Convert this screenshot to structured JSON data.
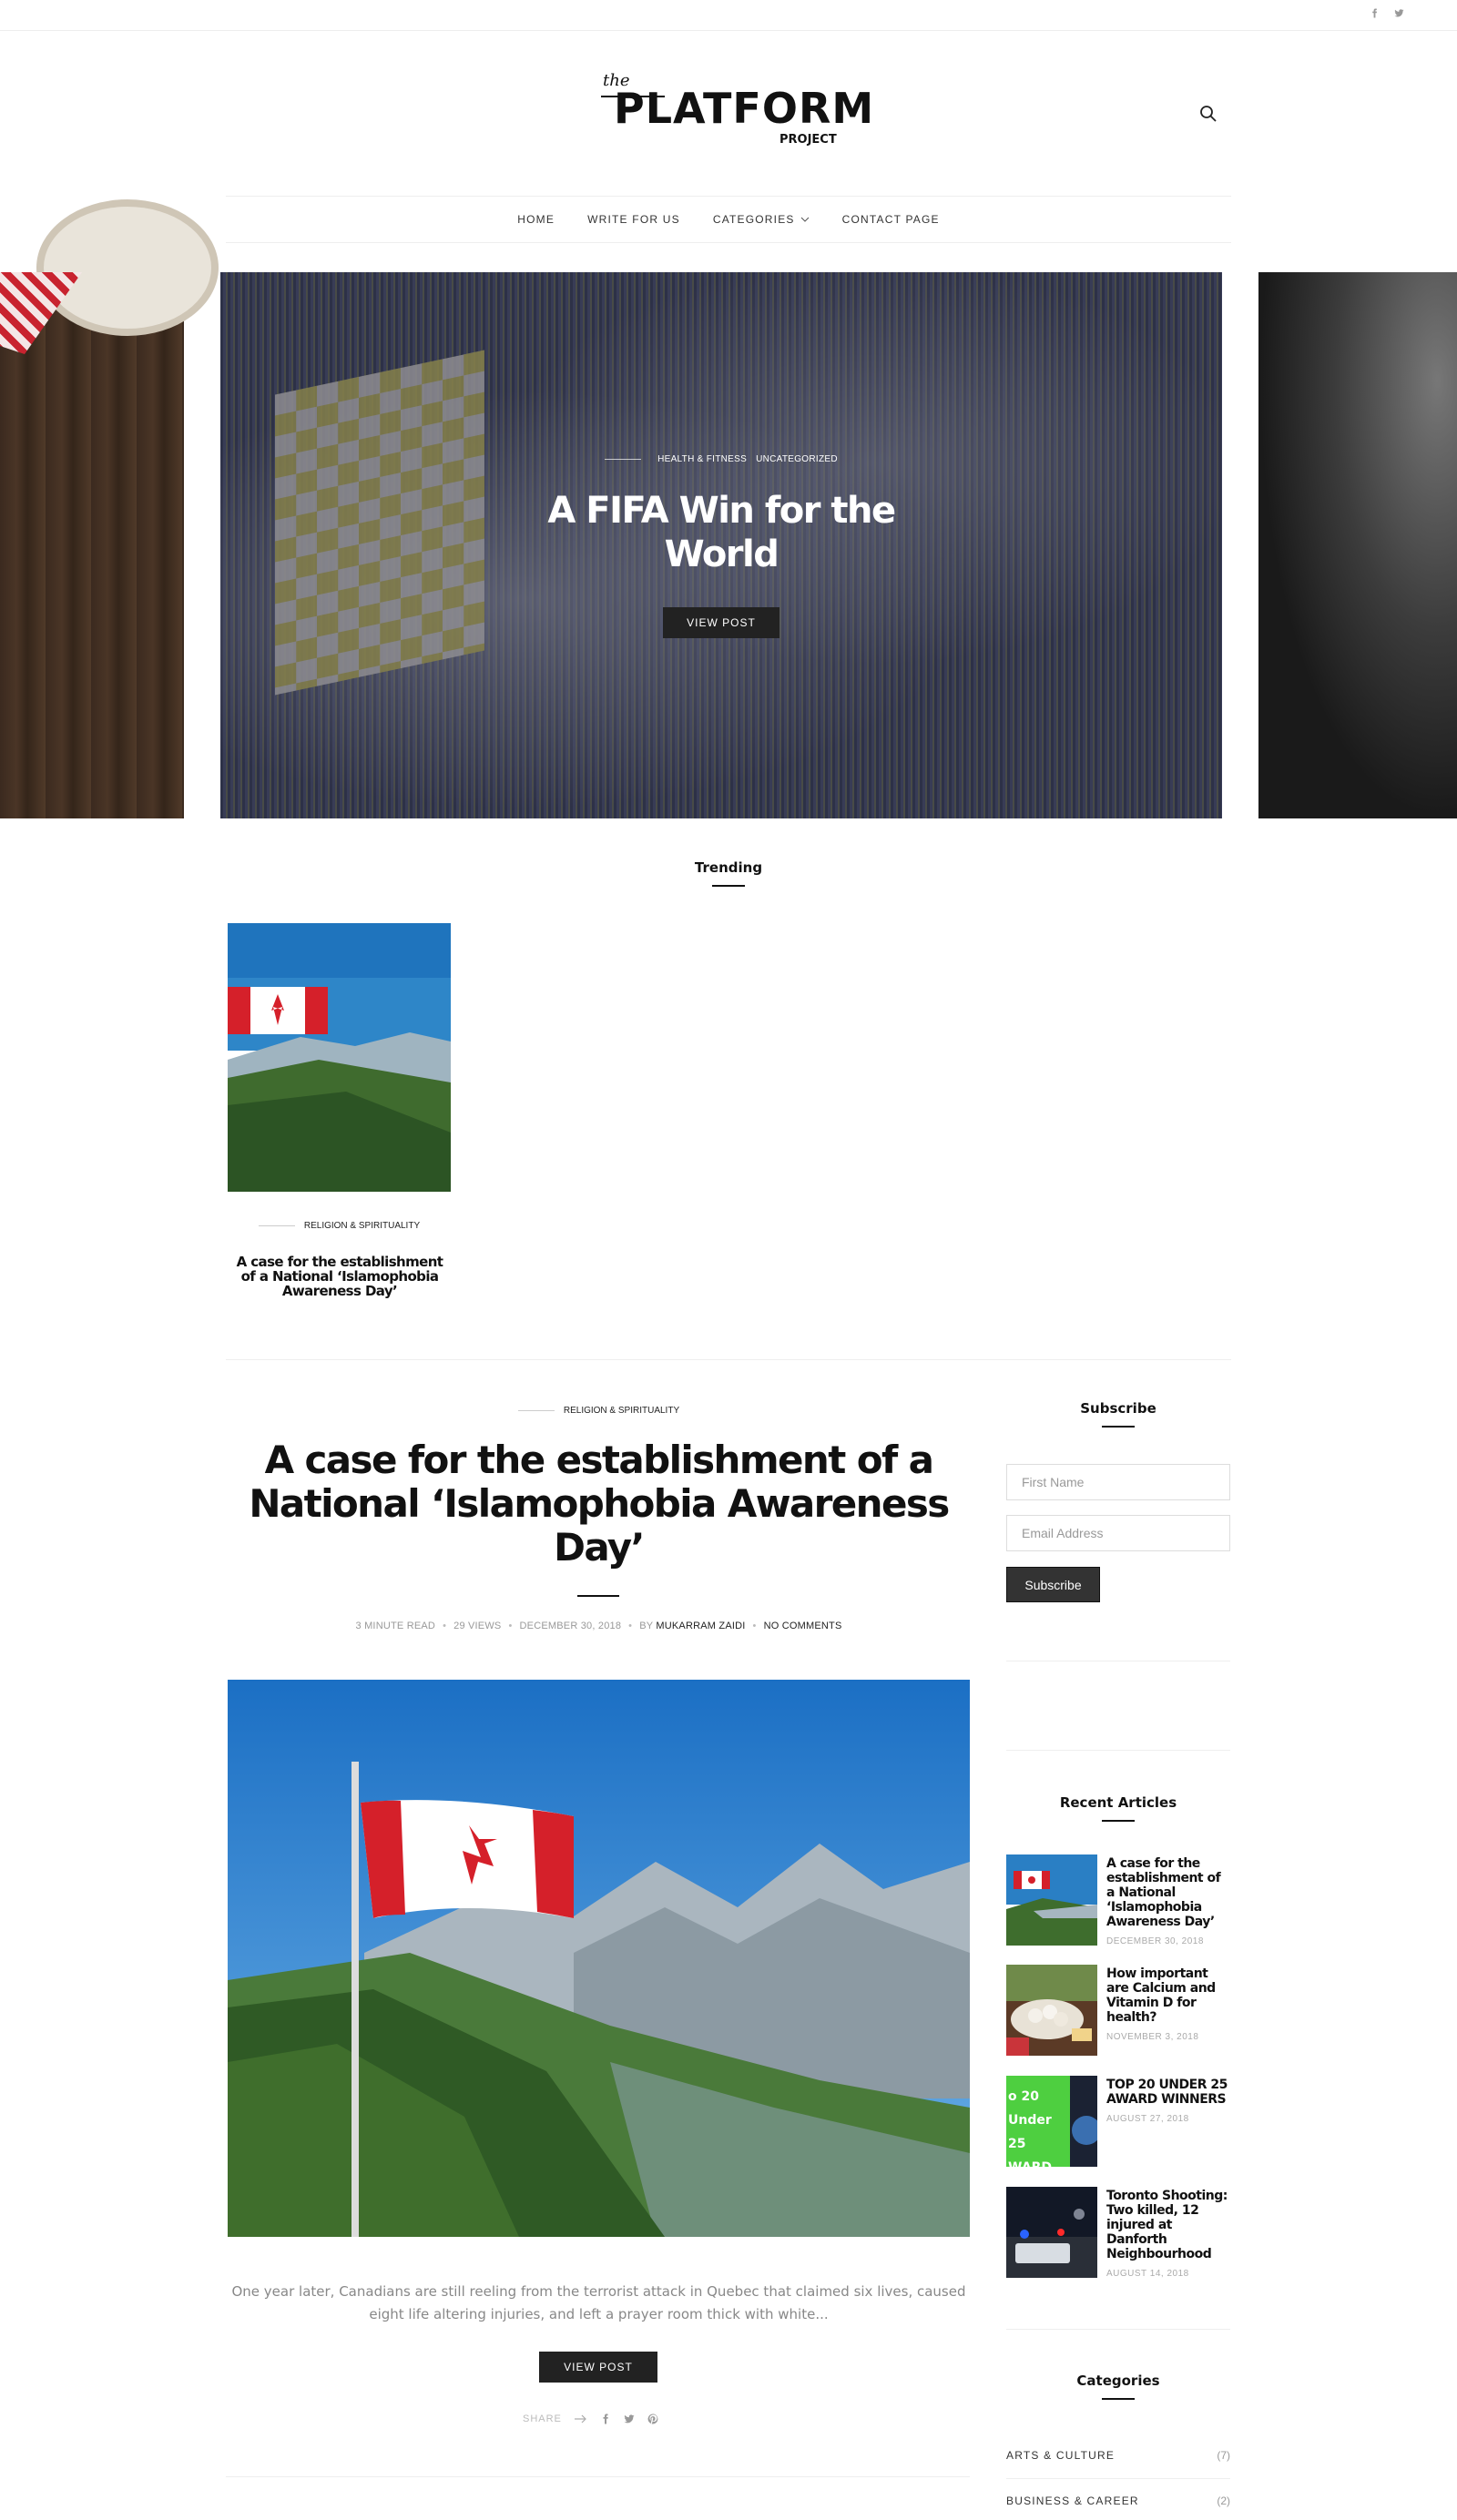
{
  "header": {
    "social": [
      "facebook-icon",
      "twitter-icon"
    ],
    "logo": {
      "the": "the",
      "main": "PLATFORM",
      "sub": "PROJECT"
    }
  },
  "nav": {
    "items": [
      {
        "label": "HOME"
      },
      {
        "label": "WRITE FOR US"
      },
      {
        "label": "CATEGORIES"
      },
      {
        "label": "CONTACT PAGE"
      }
    ]
  },
  "hero": {
    "categories": [
      "HEALTH & FITNESS",
      "UNCATEGORIZED"
    ],
    "title": "A FIFA Win for the World",
    "button": "VIEW POST"
  },
  "trending": {
    "heading": "Trending",
    "post": {
      "category": "RELIGION & SPIRITUALITY",
      "title": "A case for the establishment of a National ‘Islamophobia Awareness Day’"
    }
  },
  "main_post": {
    "category": "RELIGION & SPIRITUALITY",
    "title": "A case for the establishment of a National ‘Islamophobia Awareness Day’",
    "meta": {
      "read_time": "3 MINUTE READ",
      "views": "29 VIEWS",
      "date": "DECEMBER 30, 2018",
      "by": "BY",
      "author": "MUKARRAM ZAIDI",
      "comments": "NO COMMENTS"
    },
    "excerpt": "One year later, Canadians are still reeling from the terrorist attack in Quebec that claimed six lives, caused eight life altering injuries, and left a prayer room thick with white...",
    "button": "VIEW POST",
    "share_label": "SHARE"
  },
  "sidebar": {
    "subscribe": {
      "heading": "Subscribe",
      "first_name_placeholder": "First Name",
      "email_placeholder": "Email Address",
      "button": "Subscribe"
    },
    "recent": {
      "heading": "Recent Articles",
      "items": [
        {
          "title": "A case for the establishment of a National ‘Islamophobia Awareness Day’",
          "date": "DECEMBER 30, 2018"
        },
        {
          "title": "How important are Calcium and Vitamin D for health?",
          "date": "NOVEMBER 3, 2018"
        },
        {
          "title": "TOP 20 UNDER 25 AWARD WINNERS",
          "date": "AUGUST 27, 2018",
          "thumb_text": "o 20 Under 25 WARD"
        },
        {
          "title": "Toronto Shooting: Two killed, 12 injured at Danforth Neighbourhood",
          "date": "AUGUST 14, 2018"
        }
      ]
    },
    "categories": {
      "heading": "Categories",
      "items": [
        {
          "label": "ARTS & CULTURE",
          "count": "(7)"
        },
        {
          "label": "BUSINESS & CAREER",
          "count": "(2)"
        }
      ]
    }
  }
}
